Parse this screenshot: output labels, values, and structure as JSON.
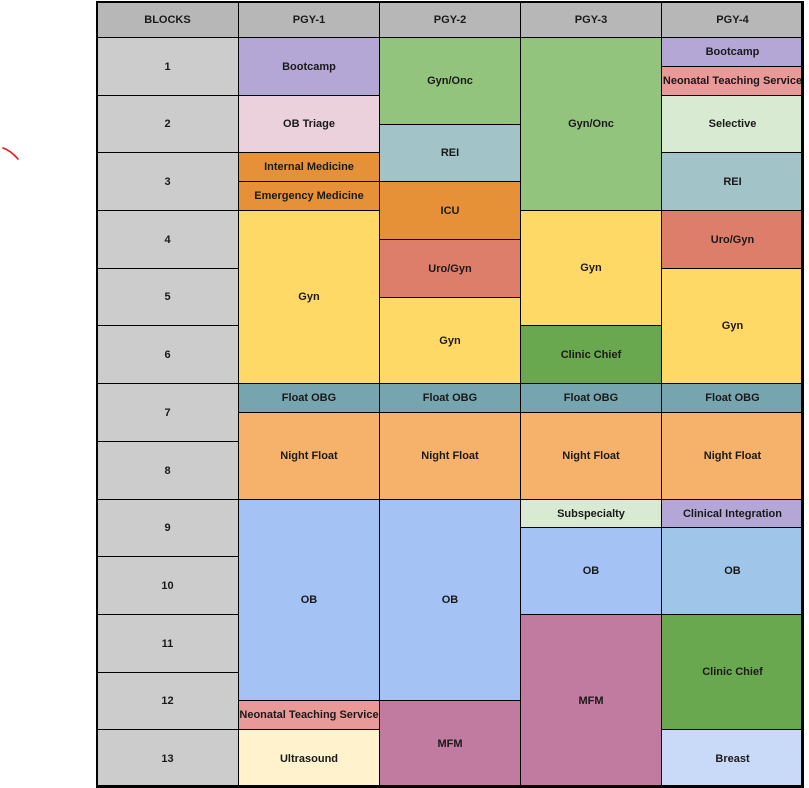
{
  "headers": [
    "BLOCKS",
    "PGY-1",
    "PGY-2",
    "PGY-3",
    "PGY-4"
  ],
  "blocks": [
    "1",
    "2",
    "3",
    "4",
    "5",
    "6",
    "7",
    "8",
    "9",
    "10",
    "11",
    "12",
    "13"
  ],
  "colors": {
    "purple": "#b4a7d6",
    "pink_light": "#ead1dc",
    "orange": "#e69138",
    "yellow": "#ffd966",
    "teal": "#76a5af",
    "peach": "#f6b26b",
    "blue": "#a4c2f4",
    "blue_alt": "#9fc5e8",
    "salmon": "#ea9999",
    "cream": "#fff2cc",
    "green": "#93c47d",
    "green_dark": "#6aa84f",
    "grayblue": "#a2c4c9",
    "red": "#dd7e6b",
    "mauve": "#c27ba0",
    "green_light": "#d9ead3",
    "breast_blue": "#c9daf8"
  },
  "rotations": [
    {
      "col": 1,
      "label": "Bootcamp",
      "start": 1,
      "end": 2,
      "color": "purple"
    },
    {
      "col": 1,
      "label": "OB Triage",
      "start": 2,
      "end": 3,
      "color": "pink_light"
    },
    {
      "col": 1,
      "label": "Internal Medicine",
      "start": 3,
      "end": 3.5,
      "color": "orange"
    },
    {
      "col": 1,
      "label": "Emergency Medicine",
      "start": 3.5,
      "end": 4,
      "color": "orange"
    },
    {
      "col": 1,
      "label": "Gyn",
      "start": 4,
      "end": 7,
      "color": "yellow"
    },
    {
      "col": 1,
      "label": "Float OBG",
      "start": 7,
      "end": 7.5,
      "color": "teal"
    },
    {
      "col": 1,
      "label": "Night Float",
      "start": 7.5,
      "end": 9,
      "color": "peach"
    },
    {
      "col": 1,
      "label": "OB",
      "start": 9,
      "end": 12.5,
      "color": "blue"
    },
    {
      "col": 1,
      "label": "Neonatal Teaching Service",
      "start": 12.5,
      "end": 13,
      "color": "salmon"
    },
    {
      "col": 1,
      "label": "Ultrasound",
      "start": 13,
      "end": 14,
      "color": "cream"
    },
    {
      "col": 2,
      "label": "Gyn/Onc",
      "start": 1,
      "end": 2.5,
      "color": "green"
    },
    {
      "col": 2,
      "label": "REI",
      "start": 2.5,
      "end": 3.5,
      "color": "grayblue"
    },
    {
      "col": 2,
      "label": "ICU",
      "start": 3.5,
      "end": 4.5,
      "color": "orange"
    },
    {
      "col": 2,
      "label": "Uro/Gyn",
      "start": 4.5,
      "end": 5.5,
      "color": "red"
    },
    {
      "col": 2,
      "label": "Gyn",
      "start": 5.5,
      "end": 7,
      "color": "yellow"
    },
    {
      "col": 2,
      "label": "Float OBG",
      "start": 7,
      "end": 7.5,
      "color": "teal"
    },
    {
      "col": 2,
      "label": "Night Float",
      "start": 7.5,
      "end": 9,
      "color": "peach"
    },
    {
      "col": 2,
      "label": "OB",
      "start": 9,
      "end": 12.5,
      "color": "blue"
    },
    {
      "col": 2,
      "label": "MFM",
      "start": 12.5,
      "end": 14,
      "color": "mauve"
    },
    {
      "col": 3,
      "label": "Gyn/Onc",
      "start": 1,
      "end": 4,
      "color": "green"
    },
    {
      "col": 3,
      "label": "Gyn",
      "start": 4,
      "end": 6,
      "color": "yellow"
    },
    {
      "col": 3,
      "label": "Clinic Chief",
      "start": 6,
      "end": 7,
      "color": "green_dark"
    },
    {
      "col": 3,
      "label": "Float OBG",
      "start": 7,
      "end": 7.5,
      "color": "teal"
    },
    {
      "col": 3,
      "label": "Night Float",
      "start": 7.5,
      "end": 9,
      "color": "peach"
    },
    {
      "col": 3,
      "label": "Subspecialty",
      "start": 9,
      "end": 9.5,
      "color": "green_light"
    },
    {
      "col": 3,
      "label": "OB",
      "start": 9.5,
      "end": 11,
      "color": "blue"
    },
    {
      "col": 3,
      "label": "MFM",
      "start": 11,
      "end": 14,
      "color": "mauve"
    },
    {
      "col": 4,
      "label": "Bootcamp",
      "start": 1,
      "end": 1.5,
      "color": "purple"
    },
    {
      "col": 4,
      "label": "Neonatal Teaching Service",
      "start": 1.5,
      "end": 2,
      "color": "salmon"
    },
    {
      "col": 4,
      "label": "Selective",
      "start": 2,
      "end": 3,
      "color": "green_light"
    },
    {
      "col": 4,
      "label": "REI",
      "start": 3,
      "end": 4,
      "color": "grayblue"
    },
    {
      "col": 4,
      "label": "Uro/Gyn",
      "start": 4,
      "end": 5,
      "color": "red"
    },
    {
      "col": 4,
      "label": "Gyn",
      "start": 5,
      "end": 7,
      "color": "yellow"
    },
    {
      "col": 4,
      "label": "Float OBG",
      "start": 7,
      "end": 7.5,
      "color": "teal"
    },
    {
      "col": 4,
      "label": "Night Float",
      "start": 7.5,
      "end": 9,
      "color": "peach"
    },
    {
      "col": 4,
      "label": "Clinical Integration",
      "start": 9,
      "end": 9.5,
      "color": "purple"
    },
    {
      "col": 4,
      "label": "OB",
      "start": 9.5,
      "end": 11,
      "color": "blue_alt"
    },
    {
      "col": 4,
      "label": "Clinic Chief",
      "start": 11,
      "end": 13,
      "color": "green_dark"
    },
    {
      "col": 4,
      "label": "Breast",
      "start": 13,
      "end": 14,
      "color": "breast_blue"
    }
  ]
}
